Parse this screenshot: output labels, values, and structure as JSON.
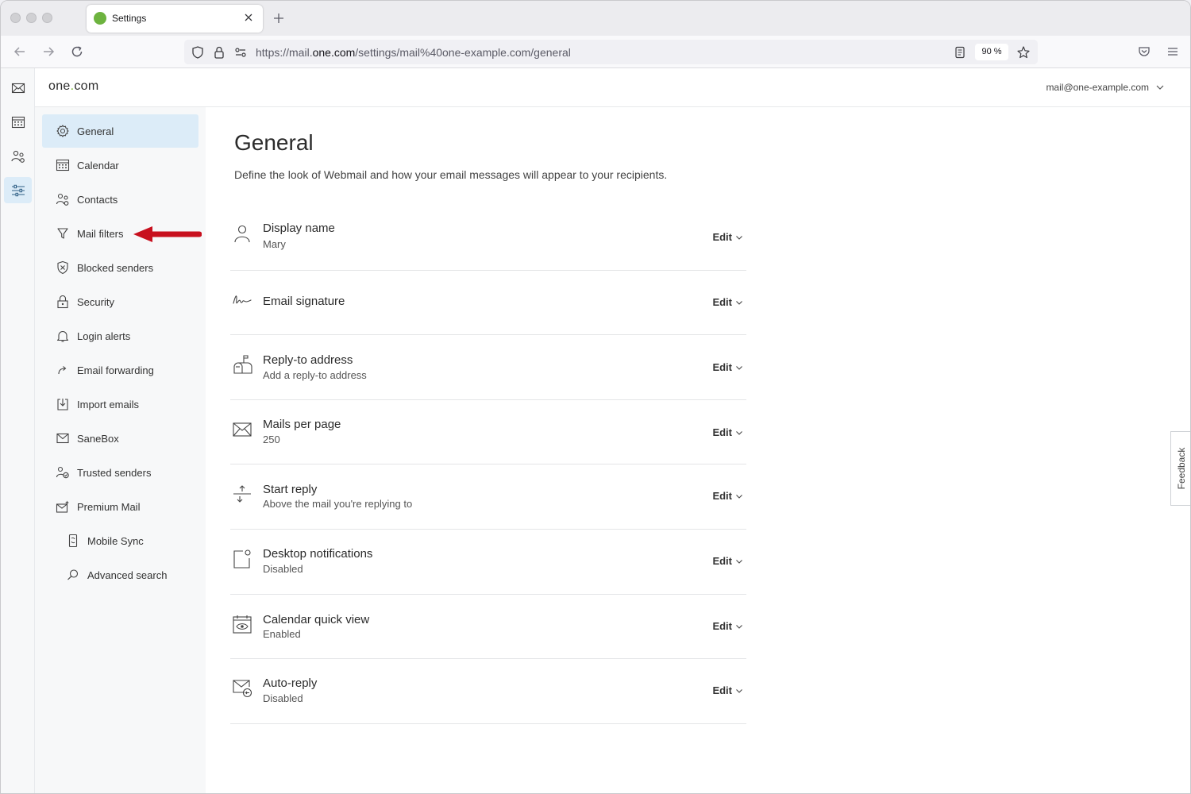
{
  "browser": {
    "tab_title": "Settings",
    "url_host_prefix": "https://mail.",
    "url_host": "one.com",
    "url_path": "/settings/mail%40one-example.com/general",
    "zoom": "90 %"
  },
  "app": {
    "logo_text": "one",
    "logo_dot": ".",
    "logo_suffix": "com",
    "account": "mail@one-example.com"
  },
  "rail": [
    "mail-icon",
    "calendar-icon",
    "contacts-icon",
    "settings-sliders-icon"
  ],
  "sidebar": {
    "items": [
      {
        "label": "General",
        "icon": "gear-icon",
        "active": true
      },
      {
        "label": "Calendar",
        "icon": "calendar-icon"
      },
      {
        "label": "Contacts",
        "icon": "contacts-icon"
      },
      {
        "label": "Mail filters",
        "icon": "filter-icon"
      },
      {
        "label": "Blocked senders",
        "icon": "shield-icon"
      },
      {
        "label": "Security",
        "icon": "lock-icon"
      },
      {
        "label": "Login alerts",
        "icon": "bell-icon"
      },
      {
        "label": "Email forwarding",
        "icon": "forward-icon"
      },
      {
        "label": "Import emails",
        "icon": "import-icon"
      },
      {
        "label": "SaneBox",
        "icon": "inbox-icon"
      },
      {
        "label": "Trusted senders",
        "icon": "trusted-icon"
      },
      {
        "label": "Premium Mail",
        "icon": "premium-mail-icon"
      },
      {
        "label": "Mobile Sync",
        "icon": "mobile-icon",
        "sub": true
      },
      {
        "label": "Advanced search",
        "icon": "search-icon",
        "sub": true
      }
    ]
  },
  "main": {
    "title": "General",
    "description": "Define the look of Webmail and how your email messages will appear to your recipients.",
    "edit_label": "Edit",
    "settings": [
      {
        "title": "Display name",
        "value": "Mary",
        "icon": "person-icon"
      },
      {
        "title": "Email signature",
        "value": "",
        "icon": "signature-icon"
      },
      {
        "title": "Reply-to address",
        "value": "Add a reply-to address",
        "icon": "mailbox-icon"
      },
      {
        "title": "Mails per page",
        "value": "250",
        "icon": "envelope-icon"
      },
      {
        "title": "Start reply",
        "value": "Above the mail you're replying to",
        "icon": "reply-position-icon"
      },
      {
        "title": "Desktop notifications",
        "value": "Disabled",
        "icon": "notification-icon"
      },
      {
        "title": "Calendar quick view",
        "value": "Enabled",
        "icon": "calendar-eye-icon"
      },
      {
        "title": "Auto-reply",
        "value": "Disabled",
        "icon": "auto-reply-icon"
      }
    ]
  },
  "feedback_label": "Feedback",
  "colors": {
    "accent": "#dcecf8",
    "brand_green": "#76b82a",
    "annotation_arrow": "#c8101e"
  }
}
